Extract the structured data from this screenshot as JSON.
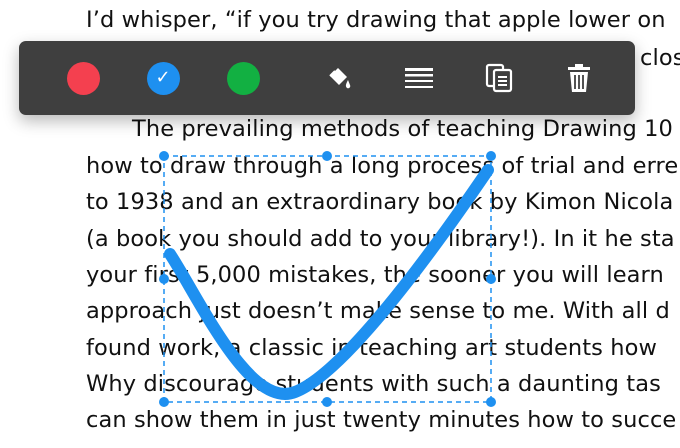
{
  "document": {
    "lines": [
      "I’d whisper, “if you try drawing that apple lower on",
      "The prevailing methods of teaching Drawing 10",
      "how to draw through a long process of trial and erre",
      "to 1938 and an extraordinary book by Kimon Nicola",
      "(a book you should add to your library!). In it he sta",
      "your first 5,000 mistakes, the sooner you will learn",
      "approach just doesn’t make sense to me. With all d",
      "found work, a classic in teaching art students how",
      "Why discourage students with such a daunting tas",
      "can show them in just twenty minutes how to succe"
    ],
    "hidden_fragment": "close"
  },
  "toolbar": {
    "colors": [
      {
        "name": "red",
        "hex": "#f4404f",
        "selected": false
      },
      {
        "name": "blue",
        "hex": "#1e90f0",
        "selected": true
      },
      {
        "name": "green",
        "hex": "#12b042",
        "selected": false
      }
    ],
    "check_glyph": "✓",
    "tools": [
      "fill-bucket-icon",
      "line-weight-icon",
      "copy-icon",
      "trash-icon"
    ]
  },
  "annotation": {
    "stroke_color": "#1e90f0",
    "selection_color": "#1e90f0"
  }
}
